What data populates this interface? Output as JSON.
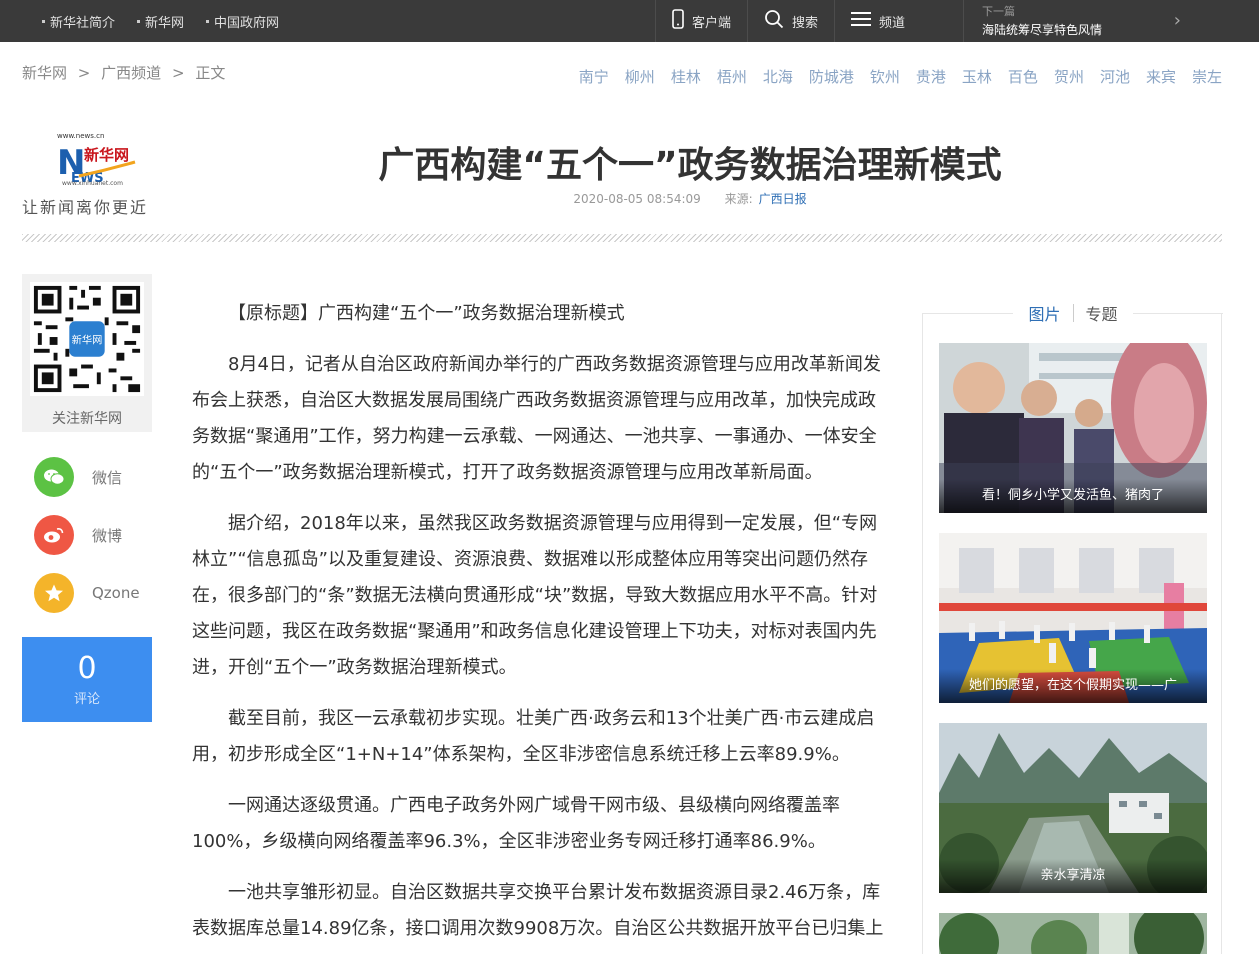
{
  "topbar": {
    "links": [
      "新华社简介",
      "新华网",
      "中国政府网"
    ],
    "tools": [
      {
        "icon": "mobile-icon",
        "label": "客户端"
      },
      {
        "icon": "search-icon",
        "label": "搜索"
      },
      {
        "icon": "menu-icon",
        "label": "频道"
      }
    ],
    "next": {
      "label": "下一篇",
      "title": "海陆统筹尽享特色风情"
    }
  },
  "breadcrumb": [
    "新华网",
    ">",
    "广西频道",
    ">",
    "正文"
  ],
  "cities": [
    "南宁",
    "柳州",
    "桂林",
    "梧州",
    "北海",
    "防城港",
    "钦州",
    "贵港",
    "玉林",
    "百色",
    "贺州",
    "河池",
    "来宾",
    "崇左"
  ],
  "logo": {
    "domain": "www.news.cn",
    "brand": "新华网",
    "sub": "www.xinhuanet.com",
    "slogan": "让新闻离你更近"
  },
  "article": {
    "title": "广西构建“五个一”政务数据治理新模式",
    "datetime": "2020-08-05 08:54:09",
    "source_label": "来源:",
    "source": "广西日报",
    "paragraphs": [
      "【原标题】广西构建“五个一”政务数据治理新模式",
      "8月4日，记者从自治区政府新闻办举行的广西政务数据资源管理与应用改革新闻发布会上获悉，自治区大数据发展局围绕广西政务数据资源管理与应用改革，加快完成政务数据“聚通用”工作，努力构建一云承载、一网通达、一池共享、一事通办、一体安全的“五个一”政务数据治理新模式，打开了政务数据资源管理与应用改革新局面。",
      "据介绍，2018年以来，虽然我区政务数据资源管理与应用得到一定发展，但“专网林立”“信息孤岛”以及重复建设、资源浪费、数据难以形成整体应用等突出问题仍然存在，很多部门的“条”数据无法横向贯通形成“块”数据，导致大数据应用水平不高。针对这些问题，我区在政务数据“聚通用”和政务信息化建设管理上下功夫，对标对表国内先进，开创“五个一”政务数据治理新模式。",
      "截至目前，我区一云承载初步实现。壮美广西·政务云和13个壮美广西·市云建成启用，初步形成全区“1+N+14”体系架构，全区非涉密信息系统迁移上云率89.9%。",
      "一网通达逐级贯通。广西电子政务外网广域骨干网市级、县级横向网络覆盖率100%，乡级横向网络覆盖率96.3%，全区非涉密业务专网迁移打通率86.9%。",
      "一池共享雏形初显。自治区数据共享交换平台累计发布数据资源目录2.46万条，库表数据库总量14.89亿条，接口调用次数9908万次。自治区公共数据开放平台已归集上"
    ]
  },
  "share": {
    "qr_label": "关注新华网",
    "items": [
      {
        "icon": "wechat-icon",
        "label": "微信",
        "color": "#5cc244"
      },
      {
        "icon": "weibo-icon",
        "label": "微博",
        "color": "#ef5744"
      },
      {
        "icon": "qzone-icon",
        "label": "Qzone",
        "color": "#f4b42a"
      }
    ],
    "comment_count": "0",
    "comment_label": "评论"
  },
  "sidebar": {
    "tabs": [
      "图片",
      "专题"
    ],
    "pictures": [
      {
        "caption": "看！侗乡小学又发活鱼、猪肉了"
      },
      {
        "caption": "她们的愿望，在这个假期实现——广"
      },
      {
        "caption": "亲水享清凉"
      },
      {
        "caption": ""
      }
    ]
  }
}
